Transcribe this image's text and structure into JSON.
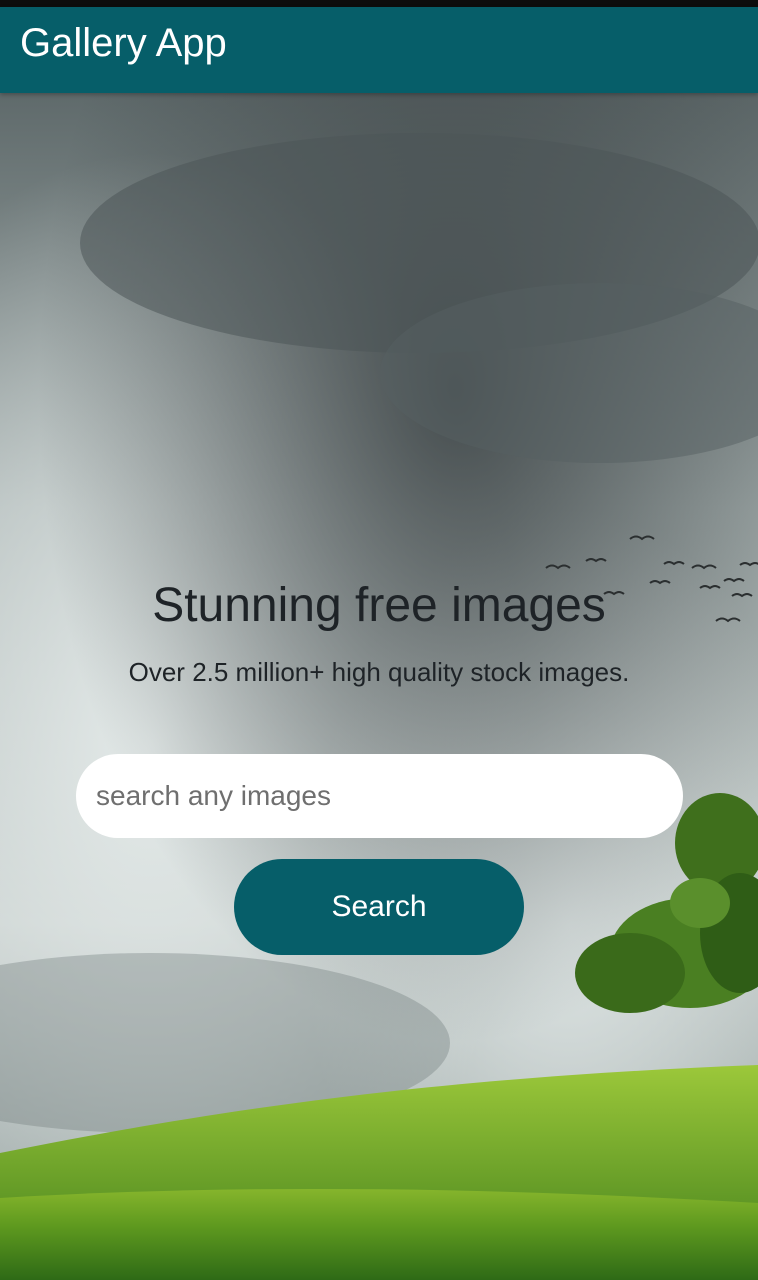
{
  "app_bar": {
    "title": "Gallery App"
  },
  "hero": {
    "headline": "Stunning free images",
    "subline": "Over 2.5 million+ high quality stock images."
  },
  "search": {
    "placeholder": "search any images",
    "value": "",
    "button_label": "Search"
  },
  "colors": {
    "primary": "#065e69",
    "status_bar": "#0d0d0d",
    "text_dark": "#1e2327",
    "input_background": "#ffffff"
  }
}
